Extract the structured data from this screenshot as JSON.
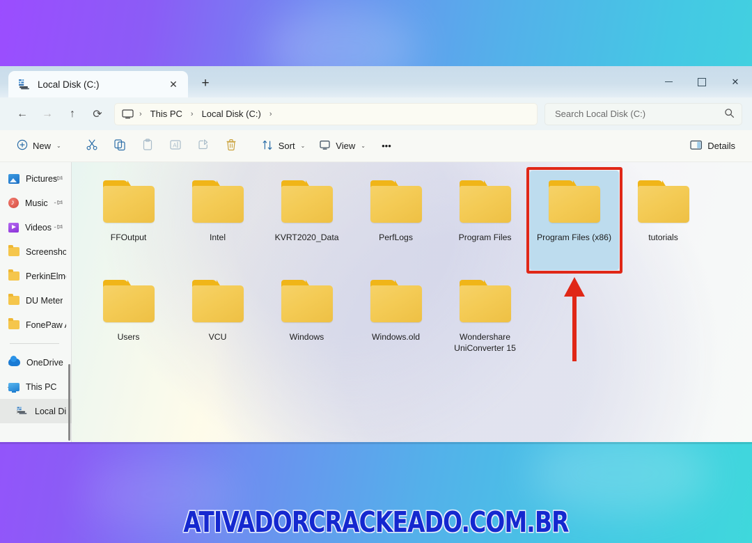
{
  "desktop": {
    "watermark": "ATIVADORCRACKEADO.COM.BR",
    "gradient_from": "#9b4dff",
    "gradient_to": "#3fd8dc",
    "watermark_color": "#1528cf"
  },
  "window": {
    "tab": {
      "title": "Local Disk (C:)",
      "icon": "local-disk-icon",
      "close_label": "✕",
      "new_tab_label": "+"
    },
    "controls": {
      "minimize": "minimize",
      "maximize": "maximize",
      "close": "✕"
    },
    "nav": {
      "back": "←",
      "forward": "→",
      "up": "↑",
      "refresh": "⟳",
      "breadcrumb": [
        "This PC",
        "Local Disk (C:)"
      ],
      "separator": "›",
      "search_placeholder": "Search Local Disk (C:)",
      "search_value": "",
      "search_icon": "⌕"
    },
    "toolbar": {
      "new_label": "New",
      "cut_label": "Cut",
      "copy_label": "Copy",
      "paste_label": "Paste",
      "rename_label": "Rename",
      "share_label": "Share",
      "delete_label": "Delete",
      "sort_label": "Sort",
      "view_label": "View",
      "more_label": "•••",
      "details_label": "Details",
      "caret": "⌄"
    }
  },
  "sidebar": {
    "items": [
      {
        "label": "Pictures",
        "icon": "pictures-icon",
        "pinned": true,
        "indent": 1,
        "chevron": "",
        "selected": false
      },
      {
        "label": "Music",
        "icon": "music-icon",
        "pinned": true,
        "indent": 1,
        "chevron": "",
        "selected": false
      },
      {
        "label": "Videos",
        "icon": "videos-icon",
        "pinned": true,
        "indent": 1,
        "chevron": "",
        "selected": false
      },
      {
        "label": "Screenshots",
        "icon": "folder-icon",
        "pinned": false,
        "indent": 1,
        "chevron": "",
        "selected": false
      },
      {
        "label": "PerkinElmer Che",
        "icon": "folder-icon",
        "pinned": false,
        "indent": 1,
        "chevron": "",
        "selected": false
      },
      {
        "label": "DU Meter",
        "icon": "folder-icon",
        "pinned": false,
        "indent": 1,
        "chevron": "",
        "selected": false
      },
      {
        "label": "FonePaw Andro",
        "icon": "folder-icon",
        "pinned": false,
        "indent": 1,
        "chevron": "",
        "selected": false
      },
      {
        "label": "OneDrive",
        "icon": "onedrive-icon",
        "pinned": false,
        "indent": 1,
        "chevron": "›",
        "selected": false
      },
      {
        "label": "This PC",
        "icon": "pc-icon",
        "pinned": false,
        "indent": 1,
        "chevron": "⌄",
        "selected": false
      },
      {
        "label": "Local Disk (C:)",
        "icon": "local-disk-icon",
        "pinned": false,
        "indent": 2,
        "chevron": "›",
        "selected": true
      }
    ],
    "divider_after_index": 6
  },
  "files": [
    {
      "name": "FFOutput",
      "type": "folder",
      "selected": false
    },
    {
      "name": "Intel",
      "type": "folder",
      "selected": false
    },
    {
      "name": "KVRT2020_Data",
      "type": "folder",
      "selected": false
    },
    {
      "name": "PerfLogs",
      "type": "folder",
      "selected": false
    },
    {
      "name": "Program Files",
      "type": "folder",
      "selected": false
    },
    {
      "name": "Program Files (x86)",
      "type": "folder",
      "selected": true
    },
    {
      "name": "tutorials",
      "type": "folder",
      "selected": false
    },
    {
      "name": "Users",
      "type": "folder",
      "selected": false
    },
    {
      "name": "VCU",
      "type": "folder",
      "selected": false
    },
    {
      "name": "Windows",
      "type": "folder",
      "selected": false
    },
    {
      "name": "Windows.old",
      "type": "folder",
      "selected": false
    },
    {
      "name": "Wondershare UniConverter 15",
      "type": "folder",
      "selected": false
    }
  ],
  "annotations": {
    "highlight_color": "#e02717",
    "highlight_target": "Program Files (x86)",
    "arrow_direction": "up"
  }
}
